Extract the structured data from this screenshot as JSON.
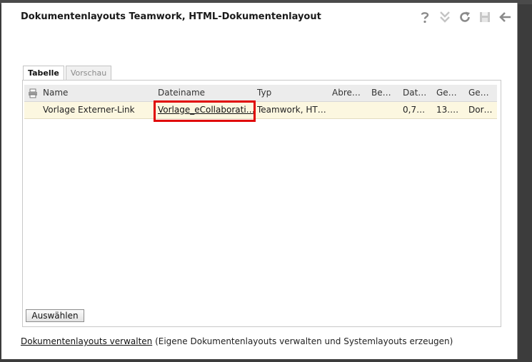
{
  "dialog": {
    "title": "Dokumentenlayouts Teamwork, HTML-Dokumentenlayout",
    "toolbar": [
      "help-icon",
      "chevron-double-down-icon",
      "refresh-icon",
      "save-icon",
      "back-arrow-icon"
    ]
  },
  "tabs": [
    {
      "label": "Tabelle",
      "active": true
    },
    {
      "label": "Vorschau",
      "active": false
    }
  ],
  "table": {
    "columns": [
      "Name",
      "Dateiname",
      "Typ",
      "Abre…",
      "Be…",
      "Dat…",
      "Ge…",
      "Ge…"
    ],
    "rows": [
      {
        "name": "Vorlage Externer-Link",
        "dateiname": "Vorlage_eCollaborati…",
        "typ": "Teamwork, HT…",
        "abre": "",
        "be": "",
        "dat": "0,7…",
        "ge1": "13.…",
        "ge2": "Dor…"
      }
    ]
  },
  "buttons": {
    "select": "Auswählen"
  },
  "footer": {
    "link": "Dokumentenlayouts verwalten",
    "text": " (Eigene Dokumentenlayouts verwalten und Systemlayouts erzeugen)"
  },
  "colors": {
    "highlight": "#e00000",
    "selected_row": "#fcf7e0"
  }
}
